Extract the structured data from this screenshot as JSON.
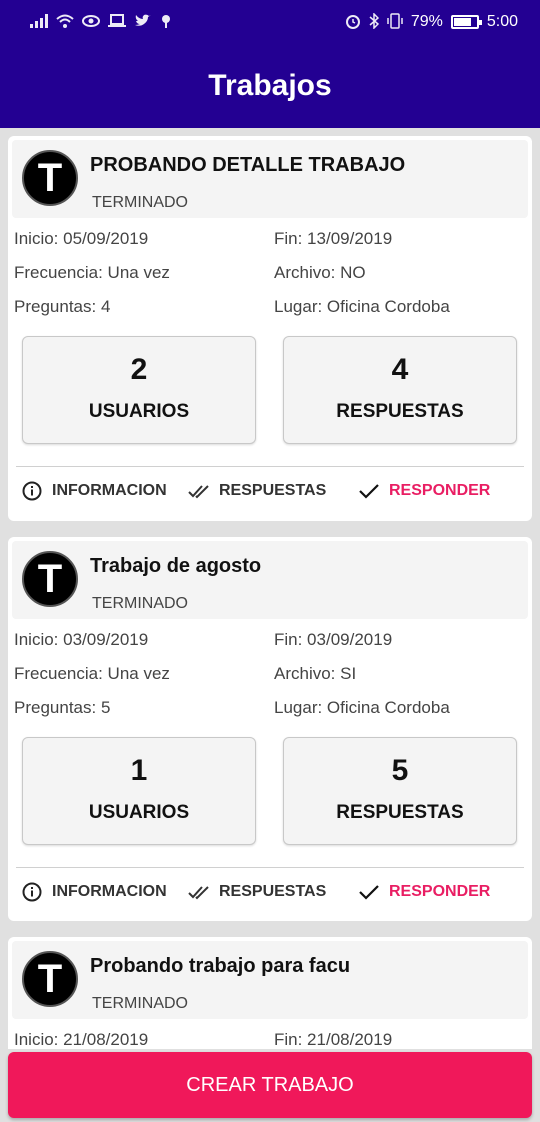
{
  "status_bar": {
    "battery": "79%",
    "time": "5:00",
    "battery_level": 0.79,
    "left_icons": [
      "signal-icon",
      "wifi-icon",
      "eye-icon",
      "laptop-icon",
      "twitter-icon",
      "location-icon"
    ],
    "right_icons": [
      "alarm-icon",
      "bluetooth-icon",
      "vibrate-icon",
      "battery-icon"
    ]
  },
  "app_bar": {
    "title": "Trabajos"
  },
  "colors": {
    "primary": "#230092",
    "accent": "#f0185a",
    "responder": "#e91e63"
  },
  "jobs": [
    {
      "avatar": "T",
      "title": "PROBANDO DETALLE TRABAJO",
      "status": "TERMINADO",
      "inicio": "Inicio: 05/09/2019",
      "fin": "Fin: 13/09/2019",
      "frecuencia": "Frecuencia: Una vez",
      "archivo": "Archivo: NO",
      "preguntas": "Preguntas: 4",
      "lugar": "Lugar: Oficina Cordoba",
      "usuarios_count": "2",
      "usuarios_label": "USUARIOS",
      "respuestas_count": "4",
      "respuestas_label": "RESPUESTAS",
      "actions": {
        "informacion": "INFORMACION",
        "respuestas": "RESPUESTAS",
        "responder": "RESPONDER"
      }
    },
    {
      "avatar": "T",
      "title": "Trabajo de agosto",
      "status": "TERMINADO",
      "inicio": "Inicio: 03/09/2019",
      "fin": "Fin: 03/09/2019",
      "frecuencia": "Frecuencia: Una vez",
      "archivo": "Archivo: SI",
      "preguntas": "Preguntas: 5",
      "lugar": "Lugar: Oficina Cordoba",
      "usuarios_count": "1",
      "usuarios_label": "USUARIOS",
      "respuestas_count": "5",
      "respuestas_label": "RESPUESTAS",
      "actions": {
        "informacion": "INFORMACION",
        "respuestas": "RESPUESTAS",
        "responder": "RESPONDER"
      }
    },
    {
      "avatar": "T",
      "title": "Probando trabajo para facu",
      "status": "TERMINADO",
      "inicio": "Inicio: 21/08/2019",
      "fin": "Fin: 21/08/2019"
    }
  ],
  "create_button": "CREAR TRABAJO"
}
